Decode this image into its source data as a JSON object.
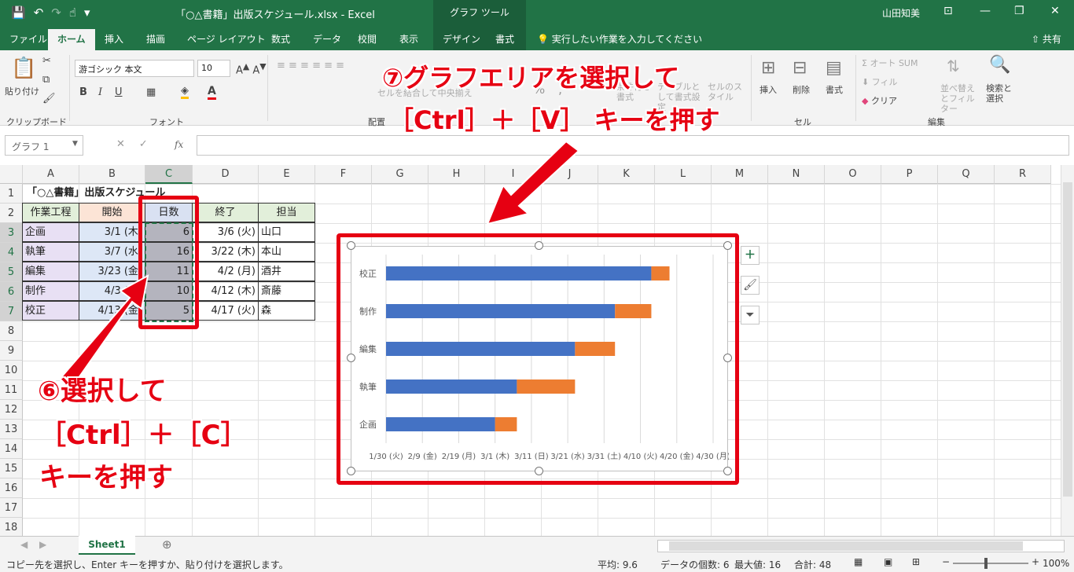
{
  "titlebar": {
    "qat_icons": [
      "save-icon",
      "undo-icon",
      "redo-icon",
      "touch-mode-icon",
      "customize-icon"
    ],
    "document_title": "「○△書籍」出版スケジュール.xlsx  -  Excel",
    "context_tab": "グラフ ツール",
    "user": "山田知美"
  },
  "tabs": [
    "ファイル",
    "ホーム",
    "挿入",
    "描画",
    "ページ レイアウト",
    "数式",
    "データ",
    "校閲",
    "表示",
    "デザイン",
    "書式"
  ],
  "active_tab": "ホーム",
  "tellme": "実行したい作業を入力してください",
  "share": "共有",
  "ribbon": {
    "clipboard": {
      "group": "クリップボード",
      "paste": "貼り付け"
    },
    "font": {
      "group": "フォント",
      "name": "游ゴシック 本文",
      "size": "10",
      "bold": "B",
      "italic": "I",
      "underline": "U"
    },
    "alignment": {
      "group": "配置",
      "merge": "セルを結合して中央揃え"
    },
    "number": {
      "percent": "%",
      "comma": ","
    },
    "styles": {
      "cond": "条件付き書式",
      "table": "テーブルとして書式設定",
      "cell": "セルのスタイル"
    },
    "cells": {
      "group": "セル",
      "insert": "挿入",
      "delete": "削除",
      "format": "書式"
    },
    "editing": {
      "group": "編集",
      "autosum": "オート SUM",
      "fill": "フィル",
      "clear": "クリア",
      "sort": "並べ替えとフィルター",
      "find": "検索と選択"
    }
  },
  "formula_bar": {
    "name_box": "グラフ 1",
    "fx": "fx",
    "value": ""
  },
  "columns": [
    "A",
    "B",
    "C",
    "D",
    "E",
    "F",
    "G",
    "H",
    "I",
    "J",
    "K",
    "L",
    "M",
    "N",
    "O",
    "P",
    "Q",
    "R"
  ],
  "rows": [
    "1",
    "2",
    "3",
    "4",
    "5",
    "6",
    "7",
    "8",
    "9",
    "10",
    "11",
    "12",
    "13",
    "14",
    "15",
    "16",
    "17",
    "18"
  ],
  "sheet": {
    "title": "「○△書籍」出版スケジュール",
    "headers": [
      "作業工程",
      "開始",
      "日数",
      "終了",
      "担当"
    ],
    "data": [
      [
        "企画",
        "3/1 (木)",
        "6",
        "3/6 (火)",
        "山口"
      ],
      [
        "執筆",
        "3/7 (水)",
        "16",
        "3/22 (木)",
        "本山"
      ],
      [
        "編集",
        "3/23 (金)",
        "11",
        "4/2 (月)",
        "酒井"
      ],
      [
        "制作",
        "4/3 (火)",
        "10",
        "4/12 (木)",
        "斎藤"
      ],
      [
        "校正",
        "4/13 (金)",
        "5",
        "4/17 (火)",
        "森"
      ]
    ]
  },
  "chart_data": {
    "type": "bar",
    "orientation": "horizontal-stacked",
    "categories": [
      "企画",
      "執筆",
      "編集",
      "制作",
      "校正"
    ],
    "series": [
      {
        "values": [
          "3/1",
          "3/7",
          "3/23",
          "4/3",
          "4/13"
        ],
        "color": "#4472c4"
      },
      {
        "values": [
          6,
          16,
          11,
          10,
          5
        ],
        "color": "#ed7d31"
      }
    ],
    "x_tick_labels": [
      "1/30 (火)",
      "2/9 (金)",
      "2/19 (月)",
      "3/1 (木)",
      "3/11 (日)",
      "3/21 (水)",
      "3/31 (土)",
      "4/10 (火)",
      "4/20 (金)",
      "4/30 (月)"
    ],
    "xlim": [
      "1/30",
      "4/30"
    ],
    "grid": true
  },
  "callouts": {
    "step6_line1": "⑥選択して",
    "step6_line2": "［Ctrl］＋［C］",
    "step6_line3": "キーを押す",
    "step7_line1": "⑦グラフエリアを選択して",
    "step7_line2": "［Ctrl］＋［V］ キーを押す"
  },
  "chart_buttons": [
    "plus-icon",
    "brush-icon",
    "filter-icon"
  ],
  "sheet_tab": "Sheet1",
  "status": {
    "message": "コピー先を選択し、Enter キーを押すか、貼り付けを選択します。",
    "average": "平均: 9.6",
    "count": "データの個数: 6",
    "max": "最大値: 16",
    "sum": "合計: 48",
    "zoom": "100%"
  },
  "colors": {
    "excel_green": "#217346",
    "accent_red": "#e60012",
    "bar_blue": "#4472c4",
    "bar_orange": "#ed7d31"
  }
}
